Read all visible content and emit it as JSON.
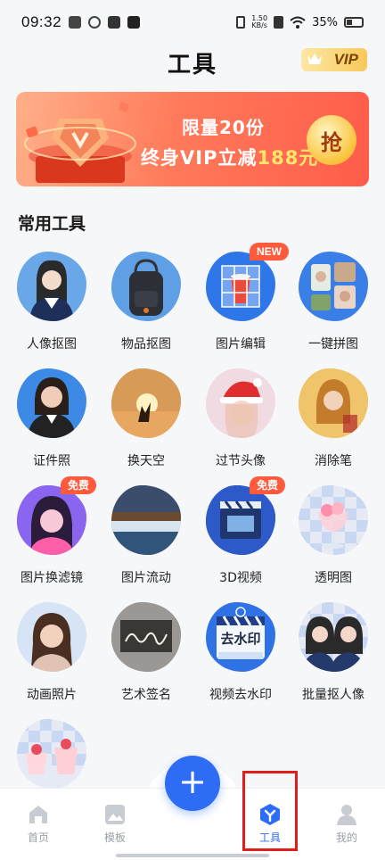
{
  "status_bar": {
    "time": "09:32",
    "net_speed_value": "1.50",
    "net_speed_unit": "KB/s",
    "battery": "35%"
  },
  "header": {
    "title": "工具",
    "vip_label": "VIP"
  },
  "banner": {
    "line1": "限量20份",
    "line2_prefix": "终身VIP立减",
    "line2_highlight": "188元",
    "cta": "抢"
  },
  "section": {
    "title": "常用工具"
  },
  "tools": [
    {
      "label": "人像抠图",
      "badge": ""
    },
    {
      "label": "物品抠图",
      "badge": ""
    },
    {
      "label": "图片编辑",
      "badge": "NEW"
    },
    {
      "label": "一键拼图",
      "badge": ""
    },
    {
      "label": "证件照",
      "badge": ""
    },
    {
      "label": "换天空",
      "badge": ""
    },
    {
      "label": "过节头像",
      "badge": ""
    },
    {
      "label": "消除笔",
      "badge": ""
    },
    {
      "label": "图片换滤镜",
      "badge": "免费"
    },
    {
      "label": "图片流动",
      "badge": ""
    },
    {
      "label": "3D视频",
      "badge": "免费"
    },
    {
      "label": "透明图",
      "badge": ""
    },
    {
      "label": "动画照片",
      "badge": ""
    },
    {
      "label": "艺术签名",
      "badge": ""
    },
    {
      "label": "视频去水印",
      "badge": ""
    },
    {
      "label": "批量抠人像",
      "badge": ""
    },
    {
      "label": "",
      "badge": ""
    }
  ],
  "watermark_text": "去水印",
  "bottom_nav": {
    "home": "首页",
    "templates": "模板",
    "tools": "工具",
    "mine": "我的"
  },
  "colors": {
    "accent": "#2f6cf6",
    "badge": "#ff5a3c",
    "highlight_box": "#e01d1d"
  }
}
